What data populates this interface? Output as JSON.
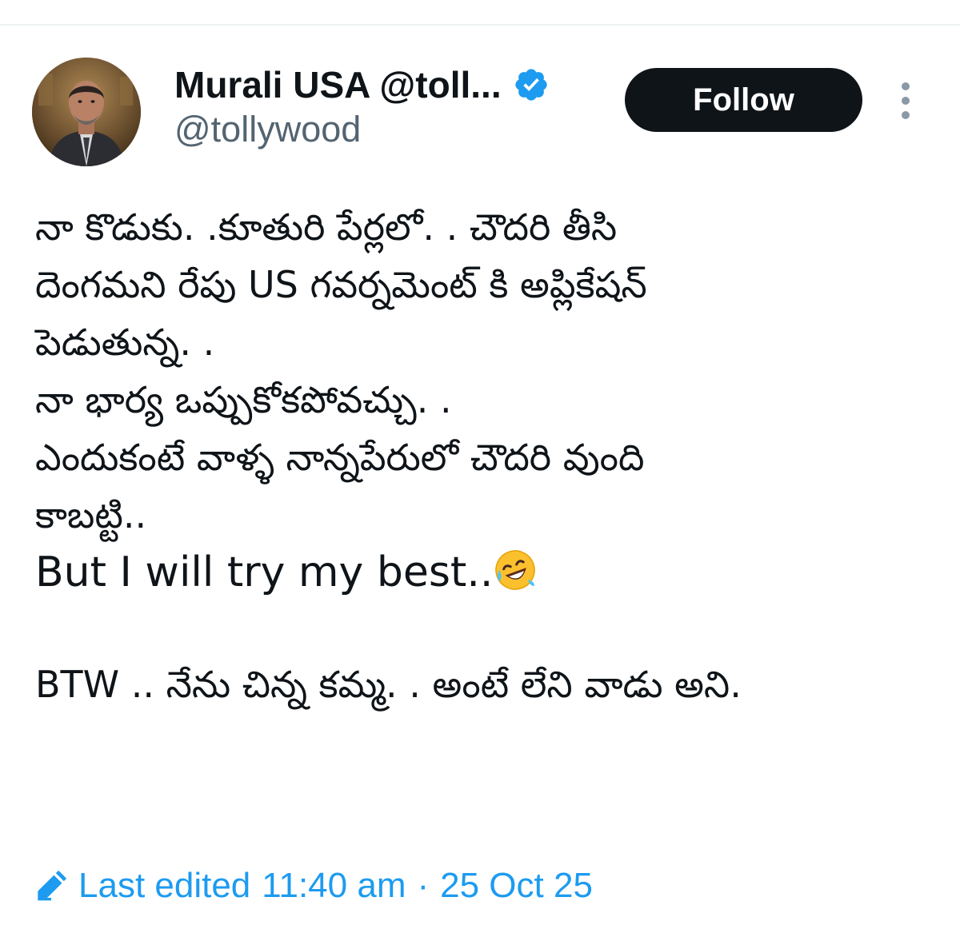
{
  "author": {
    "display_name": "Murali USA @toll...",
    "handle": "@tollywood",
    "verified": true,
    "verified_color": "#1d9bf0"
  },
  "follow_button": {
    "label": "Follow"
  },
  "tweet": {
    "lines": [
      "నా కొడుకు. .కూతురి పేర్లలో. . చౌదరి తీసి",
      "దెంగమని రేపు US గవర్నమెంట్ కి అప్లికేషన్",
      "పెడుతున్న. .",
      "నా భార్య ఒప్పుకోకపోవచ్చు. .",
      "ఎందుకంటే వాళ్ళ నాన్నపేరులో చౌదరి వుంది",
      "కాబట్టి..",
      "But I will try my best..",
      "",
      "BTW .. నేను  చిన్న కమ్మ. . అంటే లేని వాడు అని."
    ],
    "emoji": "rolling-on-floor-laughing"
  },
  "edited": {
    "prefix": "Last edited",
    "time": "11:40 am",
    "separator": "·",
    "date": "25 Oct 25",
    "color": "#1d9bf0"
  },
  "icons": {
    "more": "more-vertical-icon",
    "verified": "verified-badge-icon",
    "edit": "pencil-icon"
  }
}
